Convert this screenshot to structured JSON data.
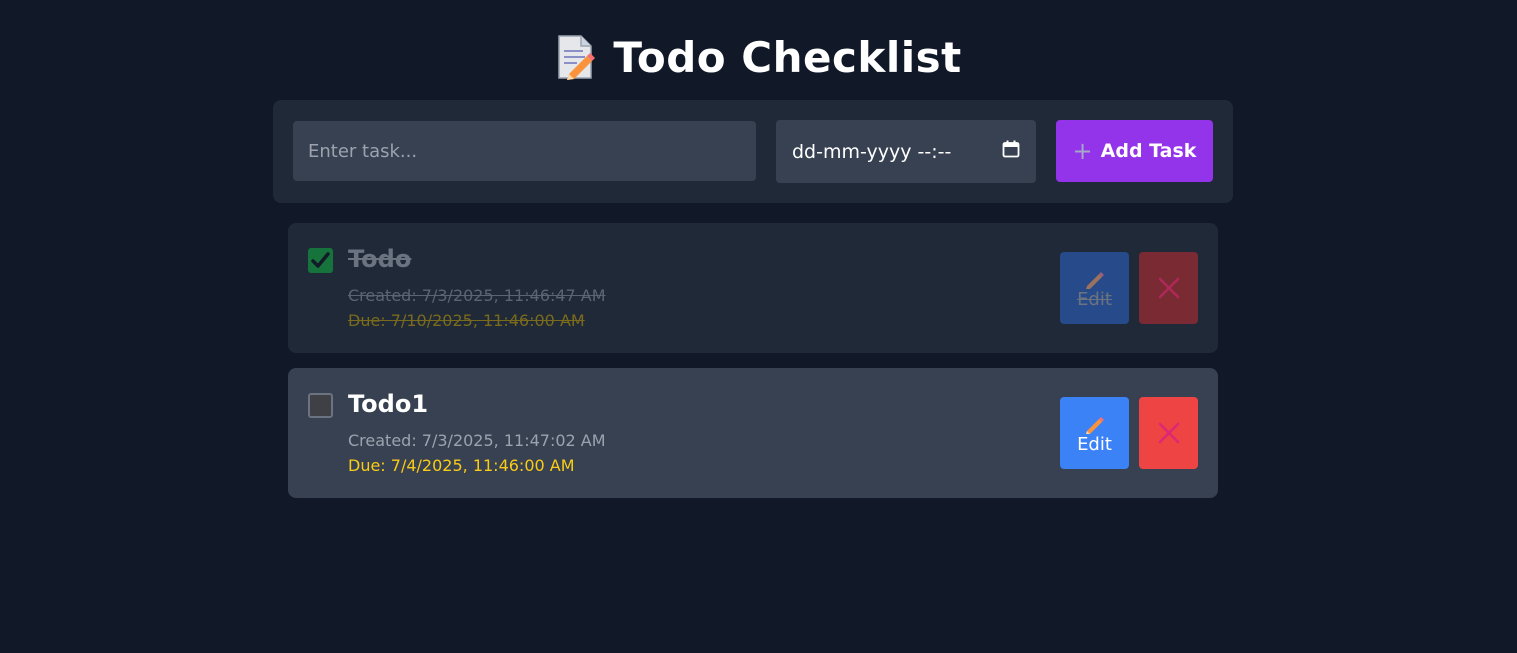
{
  "header": {
    "title": "Todo Checklist",
    "icon": "memo-icon"
  },
  "form": {
    "task_placeholder": "Enter task...",
    "date_placeholder": "dd-mm-yyyy --:--",
    "add_label": "Add Task",
    "add_icon": "plus-icon"
  },
  "todos": [
    {
      "title": "Todo",
      "completed": true,
      "created": "Created: 7/3/2025, 11:46:47 AM",
      "due": "Due: 7/10/2025, 11:46:00 AM",
      "edit_label": "Edit"
    },
    {
      "title": "Todo1",
      "completed": false,
      "created": "Created: 7/3/2025, 11:47:02 AM",
      "due": "Due: 7/4/2025, 11:46:00 AM",
      "edit_label": "Edit"
    }
  ],
  "colors": {
    "background": "#111827",
    "card": "#1f2937",
    "card_active": "#374151",
    "accent": "#9333ea",
    "edit": "#3b82f6",
    "delete": "#ef4444",
    "due": "#facc15",
    "checked": "#15803d"
  }
}
